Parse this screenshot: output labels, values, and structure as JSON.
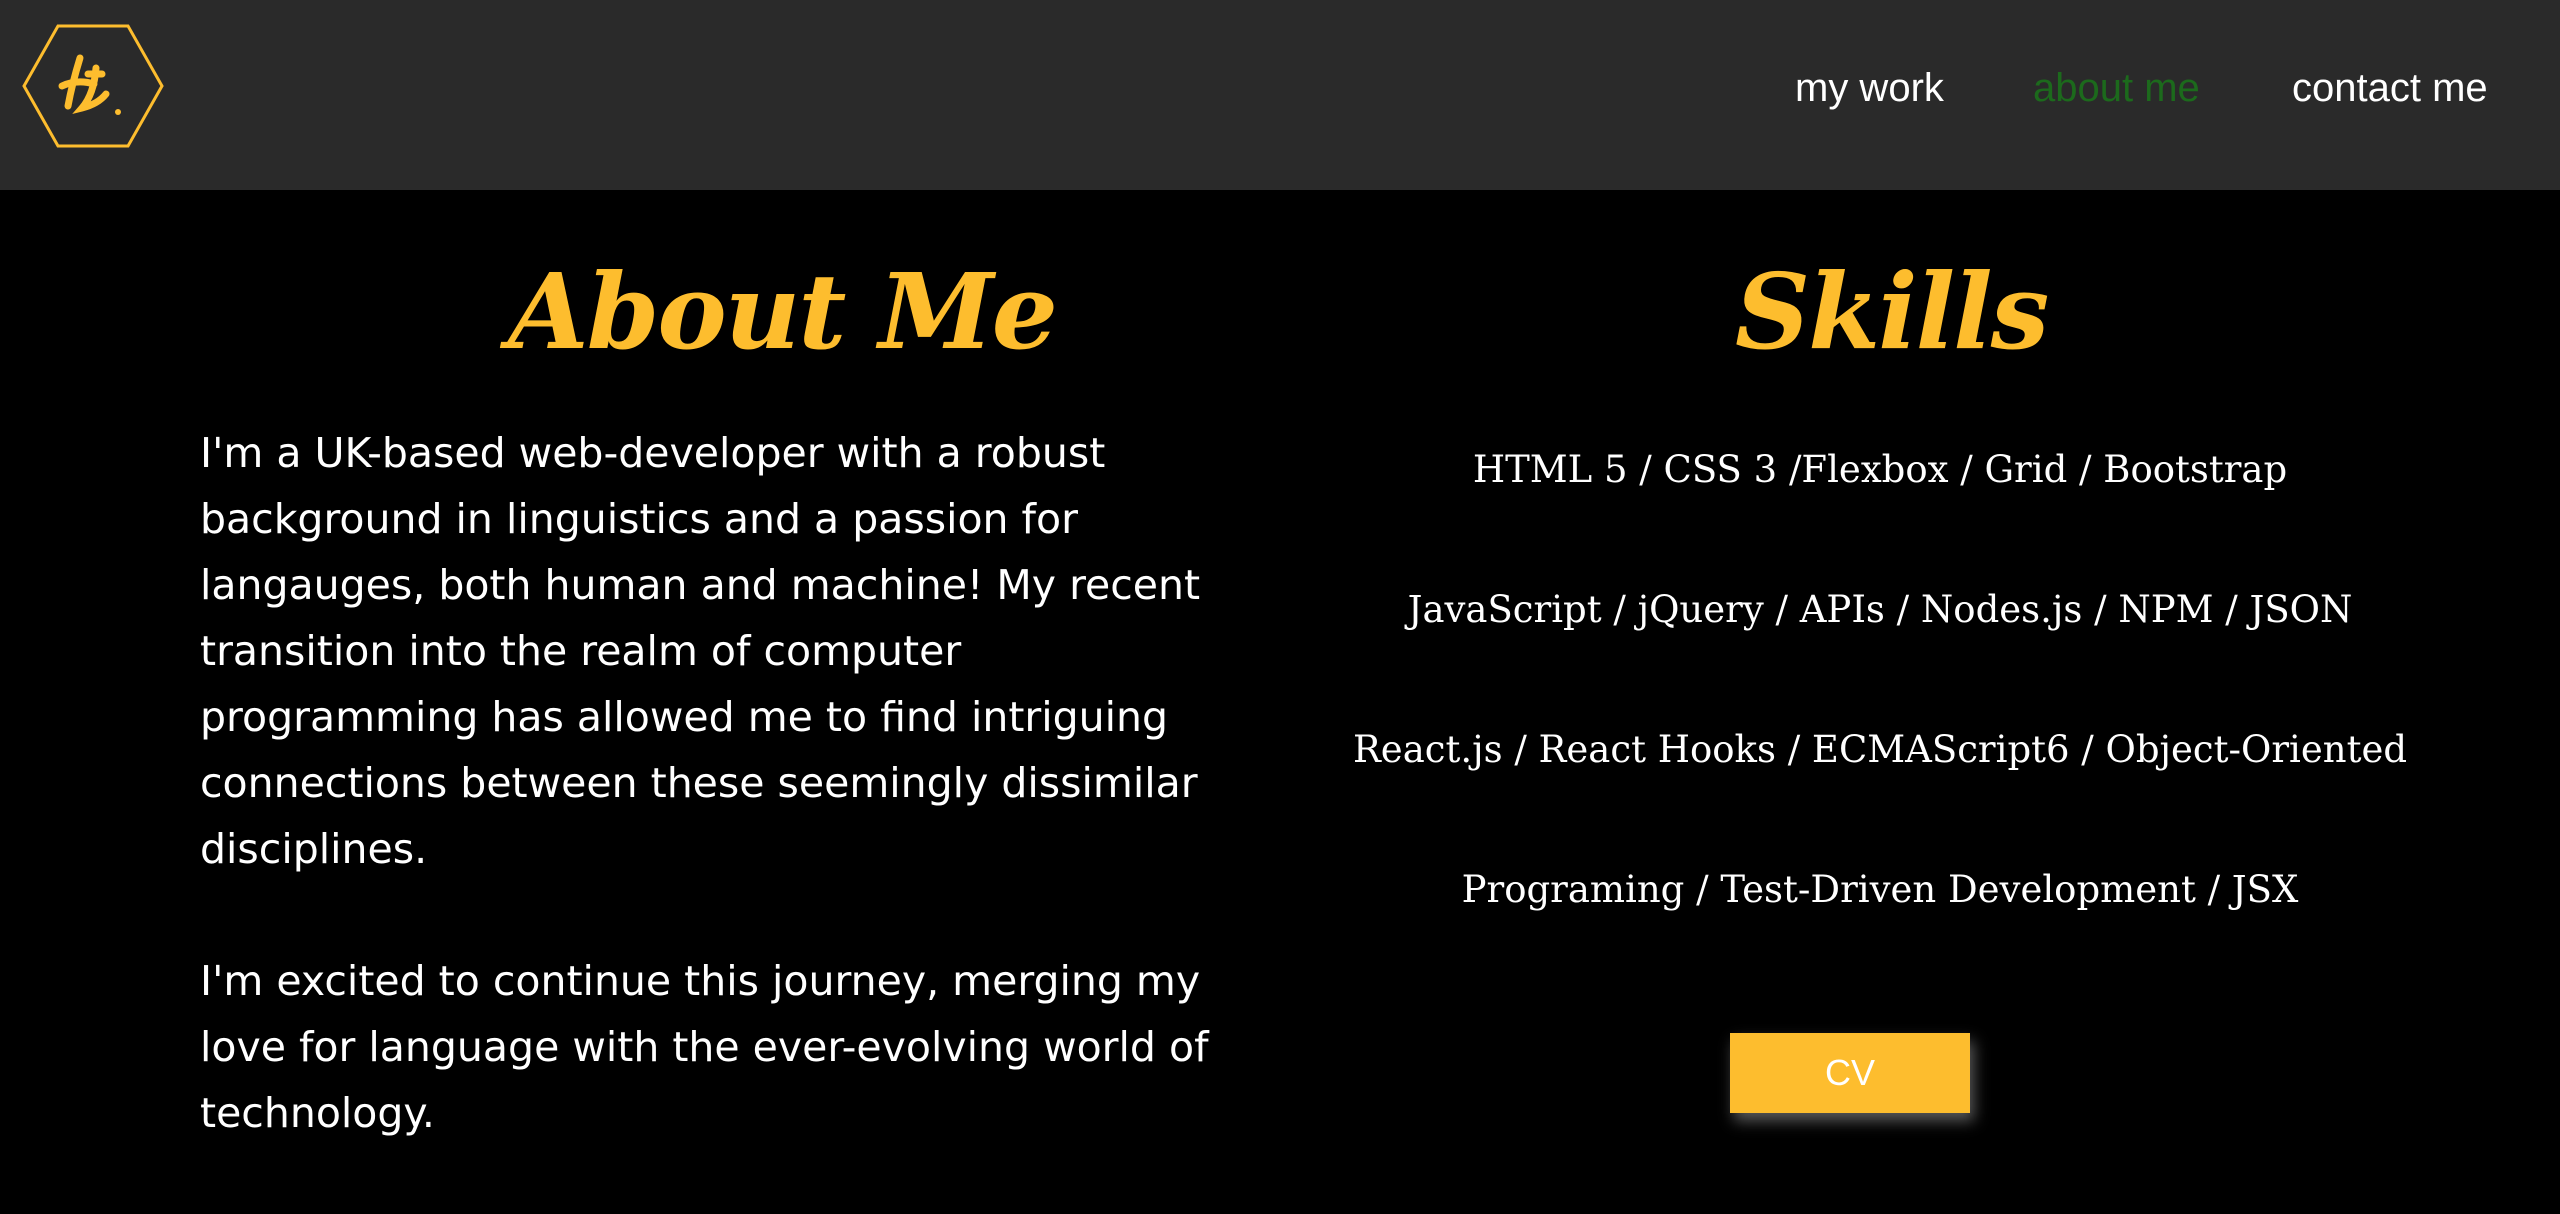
{
  "colors": {
    "accent": "#fdbd2e",
    "navbar_bg": "#2a2a2a",
    "page_bg": "#000000",
    "active_link": "#1c6a1c",
    "text": "#ffffff"
  },
  "logo": {
    "icon": "hexagon-logo-icon",
    "text": "AF"
  },
  "nav": {
    "items": [
      {
        "label": "my work",
        "active": false
      },
      {
        "label": "about me",
        "active": true
      },
      {
        "label": "contact me",
        "active": false
      }
    ]
  },
  "about": {
    "heading": "About Me",
    "paragraphs": [
      "I'm a UK-based web-developer with a robust background in linguistics and a passion for langauges, both human and machine! My recent transition into the realm of computer programming has allowed me to find intriguing connections between these seemingly dissimilar disciplines.",
      "I'm excited to continue this journey, merging my love for language with the ever-evolving world of technology."
    ]
  },
  "skills": {
    "heading": "Skills",
    "lines": [
      "HTML 5 / CSS 3 /Flexbox / Grid / Bootstrap",
      "JavaScript / jQuery / APIs / Nodes.js / NPM / JSON",
      "React.js / React Hooks / ECMAScript6 / Object-Oriented",
      "Programing / Test-Driven Development / JSX"
    ],
    "cv_label": "CV"
  }
}
